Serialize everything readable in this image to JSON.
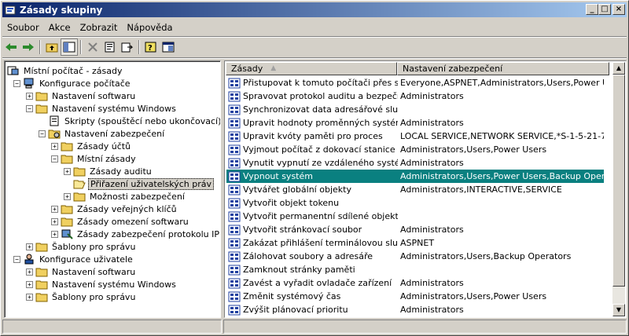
{
  "window": {
    "title": "Zásady skupiny"
  },
  "menu": [
    {
      "label": "Soubor"
    },
    {
      "label": "Akce"
    },
    {
      "label": "Zobrazit"
    },
    {
      "label": "Nápověda"
    }
  ],
  "toolbar": {
    "icons": [
      "back-icon",
      "forward-icon",
      "up-folder-icon",
      "show-tree-icon",
      "delete-icon",
      "properties-icon",
      "export-icon",
      "help-icon",
      "console-icon"
    ]
  },
  "tree": {
    "items": [
      {
        "label": "Místní počítač - zásady",
        "icon": "computer-policy-icon",
        "level": 0,
        "expander": ""
      },
      {
        "label": "Konfigurace počítače",
        "icon": "computer-icon",
        "level": 1,
        "expander": "−"
      },
      {
        "label": "Nastavení softwaru",
        "icon": "folder-icon",
        "level": 2,
        "expander": "+"
      },
      {
        "label": "Nastavení systému Windows",
        "icon": "folder-icon",
        "level": 2,
        "expander": "−"
      },
      {
        "label": "Skripty (spouštěcí nebo ukončovací)",
        "icon": "script-icon",
        "level": 3,
        "expander": ""
      },
      {
        "label": "Nastavení zabezpečení",
        "icon": "security-icon",
        "level": 3,
        "expander": "−"
      },
      {
        "label": "Zásady účtů",
        "icon": "folder-icon",
        "level": 4,
        "expander": "+"
      },
      {
        "label": "Místní zásady",
        "icon": "folder-icon",
        "level": 4,
        "expander": "−"
      },
      {
        "label": "Zásady auditu",
        "icon": "folder-icon",
        "level": 5,
        "expander": "+"
      },
      {
        "label": "Přiřazení uživatelských práv",
        "icon": "folder-open-icon",
        "level": 5,
        "expander": "",
        "selected": true
      },
      {
        "label": "Možnosti zabezpečení",
        "icon": "folder-icon",
        "level": 5,
        "expander": "+"
      },
      {
        "label": "Zásady veřejných klíčů",
        "icon": "folder-icon",
        "level": 4,
        "expander": "+"
      },
      {
        "label": "Zásady omezení softwaru",
        "icon": "folder-icon",
        "level": 4,
        "expander": "+"
      },
      {
        "label": "Zásady zabezpečení protokolu IP - M",
        "icon": "ipsec-icon",
        "level": 4,
        "expander": "+"
      },
      {
        "label": "Šablony pro správu",
        "icon": "folder-icon",
        "level": 2,
        "expander": "+"
      },
      {
        "label": "Konfigurace uživatele",
        "icon": "user-icon",
        "level": 1,
        "expander": "−"
      },
      {
        "label": "Nastavení softwaru",
        "icon": "folder-icon",
        "level": 2,
        "expander": "+"
      },
      {
        "label": "Nastavení systému Windows",
        "icon": "folder-icon",
        "level": 2,
        "expander": "+"
      },
      {
        "label": "Šablony pro správu",
        "icon": "folder-icon",
        "level": 2,
        "expander": "+"
      }
    ]
  },
  "list": {
    "columns": [
      "Zásady",
      "Nastavení zabezpečení"
    ],
    "rows": [
      {
        "policy": "Přistupovat k tomuto počítači přes síť",
        "setting": "Everyone,ASPNET,Administrators,Users,Power User..."
      },
      {
        "policy": "Spravovat protokol auditu a bezpečnosti",
        "setting": "Administrators"
      },
      {
        "policy": "Synchronizovat data adresářové služby",
        "setting": ""
      },
      {
        "policy": "Upravit hodnoty proměnných systému f...",
        "setting": "Administrators"
      },
      {
        "policy": "Upravit kvóty paměti pro proces",
        "setting": "LOCAL SERVICE,NETWORK SERVICE,*S-1-5-21-7..."
      },
      {
        "policy": "Vyjmout počítač z dokovací stanice",
        "setting": "Administrators,Users,Power Users"
      },
      {
        "policy": "Vynutit vypnutí ze vzdáleného systému",
        "setting": "Administrators"
      },
      {
        "policy": "Vypnout systém",
        "setting": "Administrators,Users,Power Users,Backup Operators",
        "selected": true
      },
      {
        "policy": "Vytvářet globální objekty",
        "setting": "Administrators,INTERACTIVE,SERVICE"
      },
      {
        "policy": "Vytvořit objekt tokenu",
        "setting": ""
      },
      {
        "policy": "Vytvořit permanentní sdílené objekty",
        "setting": ""
      },
      {
        "policy": "Vytvořit stránkovací soubor",
        "setting": "Administrators"
      },
      {
        "policy": "Zakázat přihlášení terminálovou službou",
        "setting": "ASPNET"
      },
      {
        "policy": "Zálohovat soubory a adresáře",
        "setting": "Administrators,Users,Backup Operators"
      },
      {
        "policy": "Zamknout stránky paměti",
        "setting": ""
      },
      {
        "policy": "Zavést a vyřadit ovladače zařízení",
        "setting": "Administrators"
      },
      {
        "policy": "Změnit systémový čas",
        "setting": "Administrators,Users,Power Users"
      },
      {
        "policy": "Zvýšit plánovací prioritu",
        "setting": "Administrators"
      }
    ]
  },
  "colors": {
    "selection": "#0a8080",
    "titlebar_start": "#0a246a",
    "titlebar_end": "#a6caf0"
  }
}
